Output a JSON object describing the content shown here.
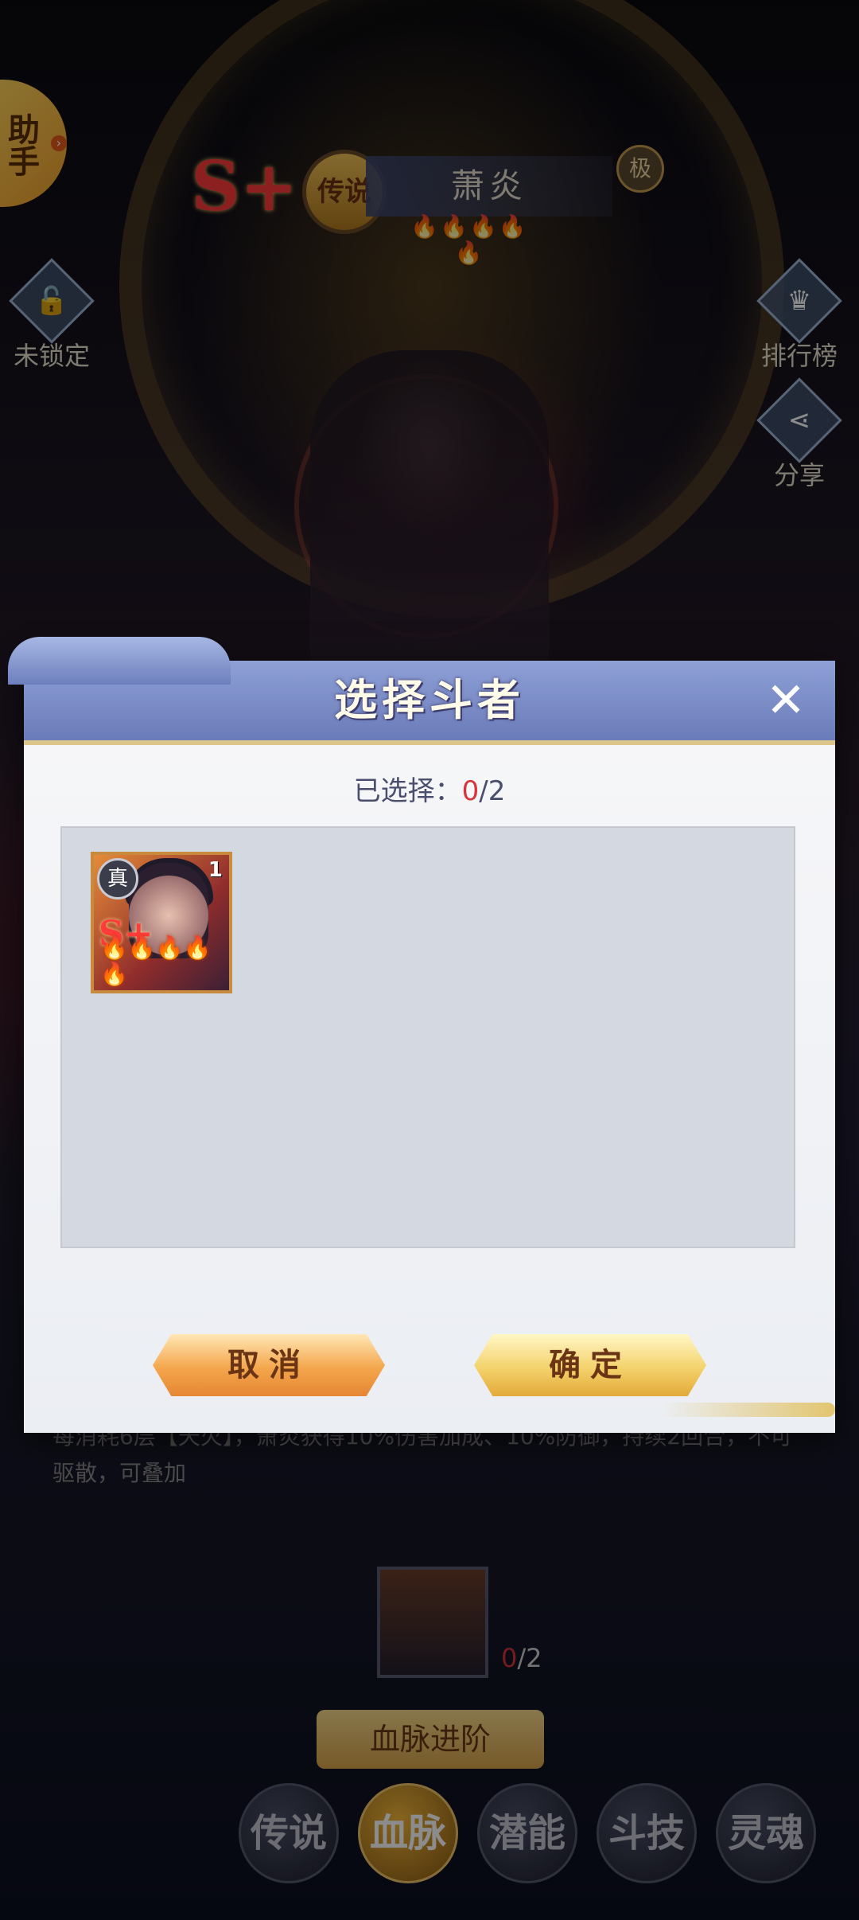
{
  "background": {
    "helper_label": "助手",
    "rank_badge": "S+",
    "legend_badge": "传说",
    "hero_name": "萧炎",
    "hero_stars": "🔥🔥🔥🔥🔥",
    "tier_badge": "极",
    "lock_label": "未锁定",
    "leaderboard_label": "排行榜",
    "share_label": "分享",
    "description": "每消耗6层【天火】，萧炎获得10%伤害加成、10%防御，持续2回合，不可驱散，可叠加",
    "material_count_current": "0",
    "material_count_total": "/2",
    "upgrade_button": "血脉进阶",
    "tabs": [
      "传说",
      "血脉",
      "潜能",
      "斗技",
      "灵魂"
    ]
  },
  "modal": {
    "title": "选择斗者",
    "close_icon": "✕",
    "selected_prefix": "已选择：",
    "selected_count": "0",
    "selected_total": "/2",
    "cards": [
      {
        "true_badge": "真",
        "count": "1",
        "rank": "S+",
        "stars": "🔥🔥🔥🔥🔥"
      }
    ],
    "cancel_button": "取消",
    "confirm_button": "确定"
  }
}
